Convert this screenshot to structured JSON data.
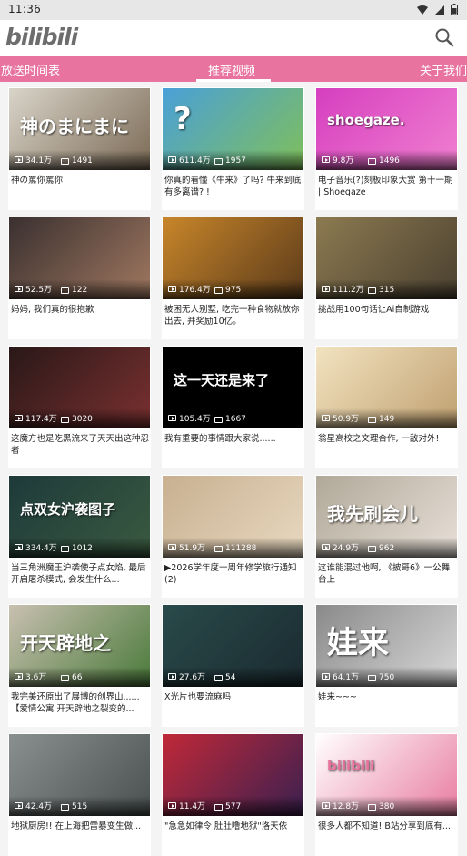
{
  "status": {
    "time": "11:36"
  },
  "app": {
    "logo": "bilibili"
  },
  "tabs": [
    "放送时间表",
    "推荐视频",
    "关于我们"
  ],
  "videos": [
    {
      "views": "34.1万",
      "danmaku": "1491",
      "title": "神の罵你罵你",
      "thumb_text": "神のまにまに",
      "colors": [
        "#d9d4c9",
        "#7b6a55"
      ]
    },
    {
      "views": "611.4万",
      "danmaku": "1957",
      "title": "你真的看懂《牛来》了吗? 牛来到底有多离谱? !",
      "thumb_text": "?",
      "colors": [
        "#4aa0d8",
        "#7fbf5a"
      ]
    },
    {
      "views": "9.8万",
      "danmaku": "1496",
      "title": "电子音乐(?)刻板印象大赏 第十一期 | Shoegaze",
      "thumb_text": "shoegaze.",
      "colors": [
        "#d63fbf",
        "#f07fd0"
      ]
    },
    {
      "views": "52.5万",
      "danmaku": "122",
      "title": "妈妈, 我们真的很抱歉",
      "thumb_text": "",
      "colors": [
        "#3a3030",
        "#a07860"
      ]
    },
    {
      "views": "176.4万",
      "danmaku": "975",
      "title": "被困无人别墅, 吃完一种食物就放你出去, 并奖励10亿。",
      "thumb_text": "",
      "colors": [
        "#c8862a",
        "#5a3a1a"
      ]
    },
    {
      "views": "111.2万",
      "danmaku": "315",
      "title": "挑战用100句话让Ai自制游戏",
      "thumb_text": "",
      "colors": [
        "#8c7a50",
        "#4a4030"
      ]
    },
    {
      "views": "117.4万",
      "danmaku": "3020",
      "title": "这魔方也是吃黑流来了天天出这种忍者",
      "thumb_text": "",
      "colors": [
        "#2a1818",
        "#7a3030"
      ]
    },
    {
      "views": "105.4万",
      "danmaku": "1667",
      "title": "我有重要的事情跟大家说......",
      "thumb_text": "这一天还是来了",
      "colors": [
        "#000000",
        "#000000"
      ]
    },
    {
      "views": "50.9万",
      "danmaku": "149",
      "title": "翁星高校之文理合作, 一敌对外!",
      "thumb_text": "",
      "colors": [
        "#f2e3c0",
        "#c0a070"
      ]
    },
    {
      "views": "334.4万",
      "danmaku": "1012",
      "title": "当三角洲魔王沪袭使子点女焰, 最后开启屠杀模式, 会发生什么...",
      "thumb_text": "点双女沪袭图子",
      "colors": [
        "#1e3a3a",
        "#3a5a40"
      ]
    },
    {
      "views": "51.9万",
      "danmaku": "111288",
      "title": "▶2026学年度一周年修学旅行通知 (2)",
      "thumb_text": "",
      "colors": [
        "#c8b090",
        "#e8d8c0"
      ]
    },
    {
      "views": "24.9万",
      "danmaku": "962",
      "title": "这谁能混过他啊, 《披哥6》一公舞台上",
      "thumb_text": "我先刷会儿",
      "colors": [
        "#b0a898",
        "#e8e0d8"
      ]
    },
    {
      "views": "3.6万",
      "danmaku": "66",
      "title": "我完美还原出了展博的创界山......【爱情公寓 开天辟地之裂变的...",
      "thumb_text": "开天辟地之",
      "colors": [
        "#c8c0b0",
        "#4a7a3a"
      ]
    },
    {
      "views": "27.6万",
      "danmaku": "54",
      "title": "X光片也要流麻吗",
      "thumb_text": "",
      "colors": [
        "#2a4a4a",
        "#1a2a30"
      ]
    },
    {
      "views": "64.1万",
      "danmaku": "750",
      "title": "娃来~~~",
      "thumb_text": "娃来",
      "colors": [
        "#8a8a8a",
        "#d8d8d8"
      ]
    },
    {
      "views": "42.4万",
      "danmaku": "515",
      "title": "地狱厨房!! 在上海把雷暴变生做...",
      "thumb_text": "",
      "colors": [
        "#8a9090",
        "#4a5050"
      ]
    },
    {
      "views": "11.4万",
      "danmaku": "577",
      "title": "\"急急如律令 肚肚噜地狱\"洛天依",
      "thumb_text": "",
      "colors": [
        "#c02838",
        "#3a2050"
      ]
    },
    {
      "views": "12.8万",
      "danmaku": "380",
      "title": "很多人都不知道! B站分享到底有...",
      "thumb_text": "bilibili",
      "colors": [
        "#ffffff",
        "#e87ca0"
      ]
    }
  ]
}
